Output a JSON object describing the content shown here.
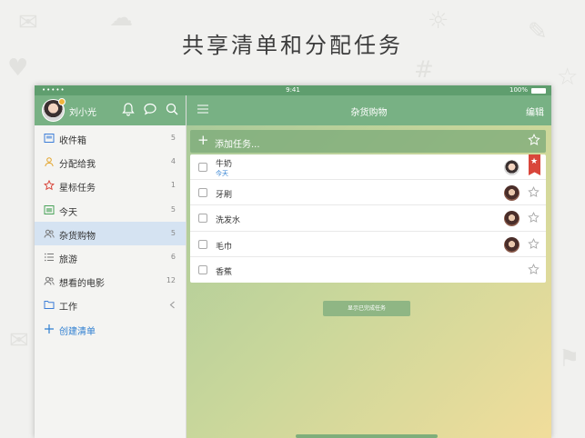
{
  "headline": "共享清单和分配任务",
  "status_bar": {
    "carrier": "•••••",
    "time": "9:41",
    "battery": "100%"
  },
  "sidebar": {
    "user_name": "刘小光",
    "lists": [
      {
        "label": "收件箱",
        "count": "5",
        "icon": "inbox-icon"
      },
      {
        "label": "分配给我",
        "count": "4",
        "icon": "assigned-person-icon"
      },
      {
        "label": "星标任务",
        "count": "1",
        "icon": "star-icon"
      },
      {
        "label": "今天",
        "count": "5",
        "icon": "calendar-icon"
      },
      {
        "label": "杂货购物",
        "count": "5",
        "icon": "shared-people-icon"
      },
      {
        "label": "旅游",
        "count": "6",
        "icon": "list-icon"
      },
      {
        "label": "想看的电影",
        "count": "12",
        "icon": "shared-people-icon"
      },
      {
        "label": "工作",
        "count": "",
        "icon": "folder-icon"
      }
    ],
    "create_list": "创建清单"
  },
  "main": {
    "title": "杂货购物",
    "edit_label": "编辑",
    "add_task_placeholder": "添加任务...",
    "tasks": [
      {
        "title": "牛奶",
        "due": "今天",
        "starred": true
      },
      {
        "title": "牙刷",
        "due": "",
        "starred": false
      },
      {
        "title": "洗发水",
        "due": "",
        "starred": false
      },
      {
        "title": "毛巾",
        "due": "",
        "starred": false
      },
      {
        "title": "香蕉",
        "due": "",
        "starred": false
      }
    ],
    "show_completed_label": "显示已完成任务"
  },
  "colors": {
    "header_green": "#78b184",
    "active_list": "#d5e3f2",
    "link_blue": "#2f7fd1",
    "star_flag_red": "#d9463b"
  }
}
